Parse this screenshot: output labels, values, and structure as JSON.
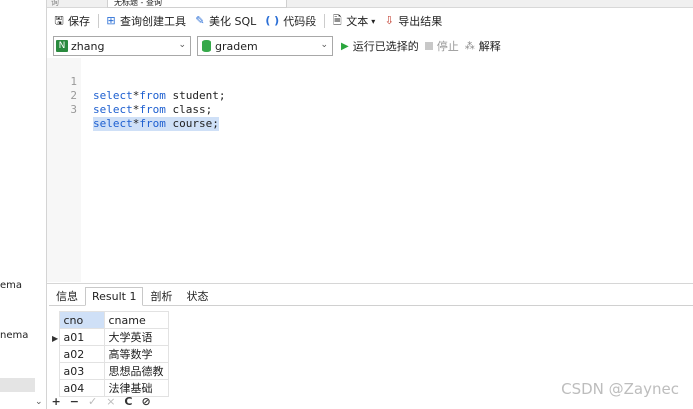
{
  "left_panel": {
    "items": [
      "ema",
      "nema"
    ]
  },
  "tabs": {
    "previous": "询",
    "current": "无标题 - 查询"
  },
  "toolbar": [
    {
      "icon": "save-icon",
      "glyph": "🖫",
      "label": "保存"
    },
    {
      "icon": "query-builder-icon",
      "glyph": "⊞",
      "label": "查询创建工具"
    },
    {
      "icon": "beautify-sql-icon",
      "glyph": "✎",
      "label": "美化 SQL"
    },
    {
      "icon": "code-snippet-icon",
      "glyph": "( )",
      "label": "代码段"
    },
    {
      "icon": "text-icon",
      "glyph": "🗎",
      "label": "文本"
    },
    {
      "icon": "export-icon",
      "glyph": "⇩",
      "label": "导出结果"
    }
  ],
  "connection": {
    "value": "zhang"
  },
  "database": {
    "value": "gradem"
  },
  "actions": {
    "run_selected": "运行已选择的",
    "stop": "停止",
    "explain": "解释"
  },
  "editor": {
    "lines": [
      {
        "num": "1",
        "kw": "select",
        "rest": "*",
        "kw2": "from",
        "tail": " student;"
      },
      {
        "num": "2",
        "kw": "select",
        "rest": "*",
        "kw2": "from",
        "tail": " class;"
      },
      {
        "num": "3",
        "kw": "select",
        "rest": "*",
        "kw2": "from",
        "tail": " course;"
      }
    ]
  },
  "result_tabs": [
    "信息",
    "Result 1",
    "剖析",
    "状态"
  ],
  "result_table": {
    "columns": [
      "cno",
      "cname"
    ],
    "rows": [
      [
        "a01",
        "大学英语"
      ],
      [
        "a02",
        "高等数学"
      ],
      [
        "a03",
        "思想品德教"
      ],
      [
        "a04",
        "法律基础"
      ]
    ]
  },
  "bottom_bar": [
    "✓",
    "+",
    "−",
    "✓",
    "×",
    "C",
    "⊘"
  ],
  "watermark": "CSDN @Zaynec",
  "colors": {
    "keyword": "#1d5fd0",
    "selection": "#cfe0f7",
    "run_green": "#2aa63d"
  }
}
